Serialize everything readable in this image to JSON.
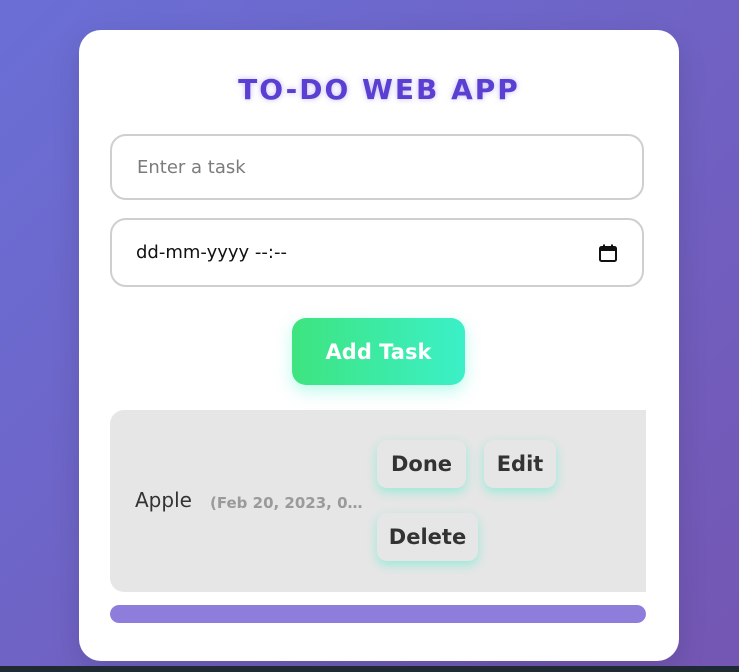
{
  "app": {
    "title": "TO-DO WEB APP"
  },
  "form": {
    "task_placeholder": "Enter a task",
    "task_value": "",
    "datetime_value": "dd-mm-yyyy --:--",
    "add_button_label": "Add Task"
  },
  "tasks": [
    {
      "name": "Apple",
      "date": "(Feb 20, 2023, 08:...",
      "done_label": "Done",
      "edit_label": "Edit",
      "delete_label": "Delete"
    }
  ],
  "progress": {
    "fraction": 1.0
  },
  "icons": {
    "calendar": "calendar-icon"
  },
  "colors": {
    "title": "#5b3fd3",
    "accent_start": "#3ee47f",
    "accent_end": "#3bf0c8",
    "progress": "#8f7ddc"
  }
}
